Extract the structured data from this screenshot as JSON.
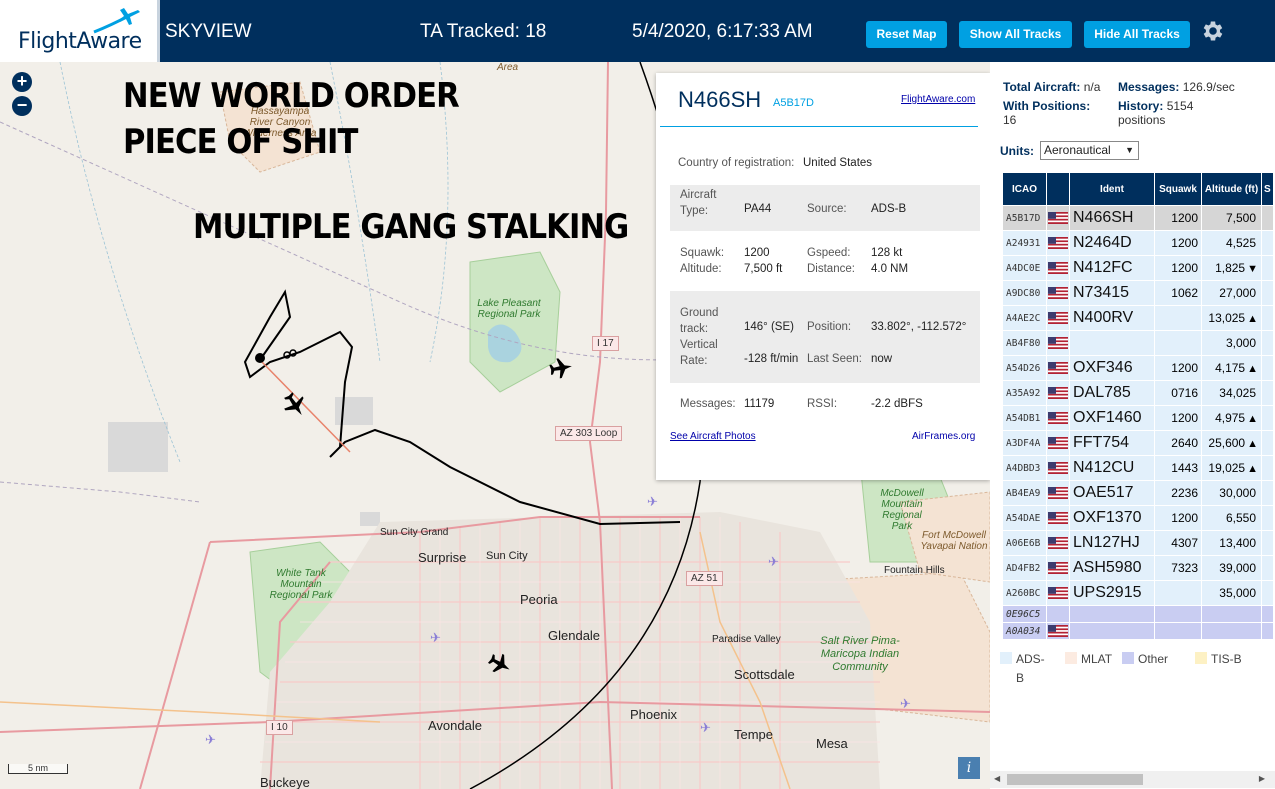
{
  "header": {
    "logo_text": "FlightAware",
    "app_name": "SKYVIEW",
    "ta_tracked": "TA Tracked: 18",
    "datetime": "5/4/2020, 6:17:33 AM",
    "reset_map": "Reset Map",
    "show_all_tracks": "Show All Tracks",
    "hide_all_tracks": "Hide All Tracks",
    "settings_icon": "gear-icon"
  },
  "map": {
    "overlay_lines": [
      "NEW WORLD ORDER",
      "PIECE OF SHIT",
      "MULTIPLE GANG STALKING"
    ],
    "labels": {
      "area": "Area",
      "hassayampa": "Hassayampa River Canyon Wilderness Area",
      "lake_pleasant": "Lake Pleasant Regional Park",
      "mcdowell": "McDowell Mountain Regional Park",
      "fort_mcdowell": "Fort McDowell Yavapai Nation",
      "white_tank": "White Tank Mountain Regional Park",
      "salt_river": "Salt River Pima-Maricopa Indian Community",
      "sun_city_grand": "Sun City Grand",
      "surprise": "Surprise",
      "sun_city": "Sun City",
      "peoria": "Peoria",
      "glendale": "Glendale",
      "paradise_valley": "Paradise Valley",
      "scottsdale": "Scottsdale",
      "fountain_hills": "Fountain Hills",
      "phoenix": "Phoenix",
      "avondale": "Avondale",
      "tempe": "Tempe",
      "mesa": "Mesa",
      "buckeye": "Buckeye"
    },
    "shields": {
      "i17": "I 17",
      "az303": "AZ 303 Loop",
      "az51": "AZ 51",
      "i10": "I 10"
    },
    "zoom_in": "+",
    "zoom_out": "−",
    "scale": "5 nm",
    "info": "i"
  },
  "popup": {
    "ident": "N466SH",
    "hex": "A5B17D",
    "flightaware_link": "FlightAware.com",
    "country_label": "Country of registration:",
    "country_value": "United States",
    "aircraft_type_label": "Aircraft Type:",
    "aircraft_type_value": "PA44",
    "source_label": "Source:",
    "source_value": "ADS-B",
    "squawk_label": "Squawk:",
    "squawk_value": "1200",
    "gspeed_label": "Gspeed:",
    "gspeed_value": "128 kt",
    "altitude_label": "Altitude:",
    "altitude_value": "7,500 ft",
    "distance_label": "Distance:",
    "distance_value": "4.0 NM",
    "ground_track_label": "Ground track:",
    "ground_track_value": "146° (SE)",
    "position_label": "Position:",
    "position_value": "33.802°, -112.572°",
    "vertical_rate_label": "Vertical Rate:",
    "vertical_rate_value": "-128 ft/min",
    "last_seen_label": "Last Seen:",
    "last_seen_value": "now",
    "messages_label": "Messages:",
    "messages_value": "11179",
    "rssi_label": "RSSI:",
    "rssi_value": "-2.2 dBFS",
    "photos_link": "See Aircraft Photos",
    "airframes_link": "AirFrames.org"
  },
  "sidebar": {
    "total_aircraft_label": "Total Aircraft:",
    "total_aircraft_value": "n/a",
    "messages_label": "Messages:",
    "messages_value": "126.9/sec",
    "with_positions_label": "With Positions:",
    "with_positions_value": "16",
    "history_label": "History:",
    "history_value": "5154 positions",
    "units_label": "Units:",
    "units_value": "Aeronautical",
    "columns": [
      "ICAO",
      "Ident",
      "Squawk",
      "Altitude (ft)",
      "S"
    ],
    "rows": [
      {
        "icao": "A5B17D",
        "ident": "N466SH",
        "squawk": "1200",
        "alt": "7,500",
        "trend": ""
      },
      {
        "icao": "A24931",
        "ident": "N2464D",
        "squawk": "1200",
        "alt": "4,525",
        "trend": ""
      },
      {
        "icao": "A4DC0E",
        "ident": "N412FC",
        "squawk": "1200",
        "alt": "1,825",
        "trend": "▼"
      },
      {
        "icao": "A9DC80",
        "ident": "N73415",
        "squawk": "1062",
        "alt": "27,000",
        "trend": ""
      },
      {
        "icao": "A4AE2C",
        "ident": "N400RV",
        "squawk": "",
        "alt": "13,025",
        "trend": "▲"
      },
      {
        "icao": "AB4F80",
        "ident": "",
        "squawk": "",
        "alt": "3,000",
        "trend": ""
      },
      {
        "icao": "A54D26",
        "ident": "OXF346",
        "squawk": "1200",
        "alt": "4,175",
        "trend": "▲"
      },
      {
        "icao": "A35A92",
        "ident": "DAL785",
        "squawk": "0716",
        "alt": "34,025",
        "trend": ""
      },
      {
        "icao": "A54DB1",
        "ident": "OXF1460",
        "squawk": "1200",
        "alt": "4,975",
        "trend": "▲"
      },
      {
        "icao": "A3DF4A",
        "ident": "FFT754",
        "squawk": "2640",
        "alt": "25,600",
        "trend": "▲"
      },
      {
        "icao": "A4DBD3",
        "ident": "N412CU",
        "squawk": "1443",
        "alt": "19,025",
        "trend": "▲"
      },
      {
        "icao": "AB4EA9",
        "ident": "OAE517",
        "squawk": "2236",
        "alt": "30,000",
        "trend": ""
      },
      {
        "icao": "A54DAE",
        "ident": "OXF1370",
        "squawk": "1200",
        "alt": "6,550",
        "trend": ""
      },
      {
        "icao": "A06E6B",
        "ident": "LN127HJ",
        "squawk": "4307",
        "alt": "13,400",
        "trend": ""
      },
      {
        "icao": "AD4FB2",
        "ident": "ASH5980",
        "squawk": "7323",
        "alt": "39,000",
        "trend": ""
      },
      {
        "icao": "A260BC",
        "ident": "UPS2915",
        "squawk": "",
        "alt": "35,000",
        "trend": ""
      }
    ],
    "other_rows": [
      {
        "icao": "0E96C5",
        "flag": false
      },
      {
        "icao": "A0A034",
        "flag": true
      }
    ],
    "legend": [
      {
        "label": "ADS-B",
        "color": "#e2f0fb"
      },
      {
        "label": "MLAT",
        "color": "#fcebe1"
      },
      {
        "label": "Other",
        "color": "#c9cdf2"
      },
      {
        "label": "TIS-B",
        "color": "#fdf1c4"
      }
    ]
  },
  "colors": {
    "header_bg": "#002f5d",
    "button_bg": "#00a0e2",
    "selected_row": "#d6d6d6",
    "adsb_row": "#e2f0fb",
    "other_row": "#c9cdf2"
  }
}
